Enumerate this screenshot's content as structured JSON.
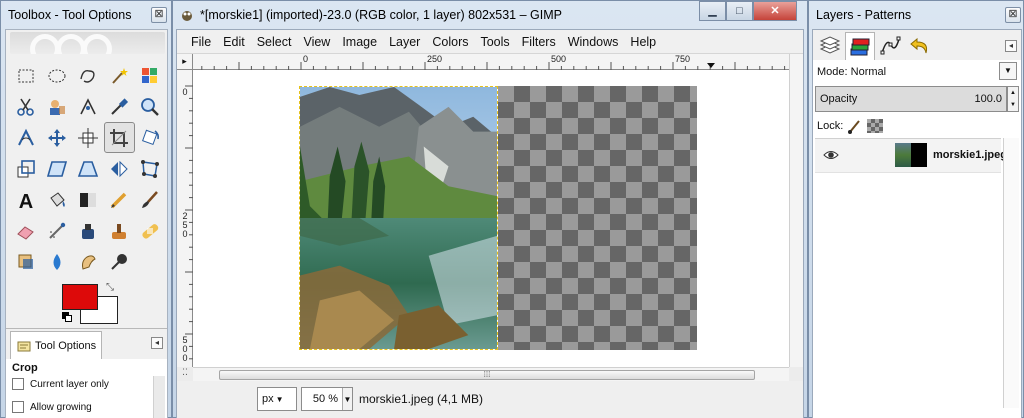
{
  "toolbox": {
    "title": "Toolbox - Tool Options",
    "close_label": "⊠",
    "tools": [
      "rect-select",
      "ellipse-select",
      "free-select",
      "fuzzy-select",
      "select-by-color",
      "scissors",
      "foreground-select",
      "paths",
      "color-picker",
      "zoom",
      "measure",
      "move",
      "align",
      "crop",
      "rotate",
      "scale",
      "shear",
      "perspective",
      "flip",
      "cage-transform",
      "text",
      "bucket-fill",
      "blend",
      "pencil",
      "paintbrush",
      "eraser",
      "airbrush",
      "ink",
      "clone",
      "heal",
      "perspective-clone",
      "blur-sharpen",
      "smudge",
      "dodge-burn",
      ""
    ],
    "active_tool_index": 13,
    "foreground_color": "#dd0a0a",
    "background_color": "#ffffff",
    "tab_label": "Tool Options",
    "tab_menu": "◂",
    "options_title": "Crop",
    "options": [
      {
        "label": "Current layer only"
      },
      {
        "label": "Allow growing"
      }
    ]
  },
  "image_window": {
    "title": "*[morskie1] (imported)-23.0 (RGB color, 1 layer) 802x531 – GIMP",
    "window_buttons": [
      "▁",
      "□",
      "✕"
    ],
    "menu": [
      "File",
      "Edit",
      "Select",
      "View",
      "Image",
      "Layer",
      "Colors",
      "Tools",
      "Filters",
      "Windows",
      "Help"
    ],
    "ruler_h_labels": [
      "0",
      "250",
      "500",
      "750"
    ],
    "ruler_v_labels": [
      "0",
      "250",
      "500"
    ],
    "unit": "px",
    "zoom": "50 %",
    "status": "morskie1.jpeg (4,1 MB)",
    "scroll_grip": "⁞⁞⁞"
  },
  "layers_window": {
    "title": "Layers - Patterns",
    "close_label": "⊠",
    "tabs": [
      "layers-tab",
      "channels-tab",
      "paths-tab",
      "undo-history-tab"
    ],
    "tab_menu": "◂",
    "mode_label": "Mode:",
    "mode_value": "Normal",
    "opacity_label": "Opacity",
    "opacity_value": "100.0",
    "lock_label": "Lock:",
    "layers": [
      {
        "name": "morskie1.jpeg",
        "visible": true
      }
    ]
  }
}
